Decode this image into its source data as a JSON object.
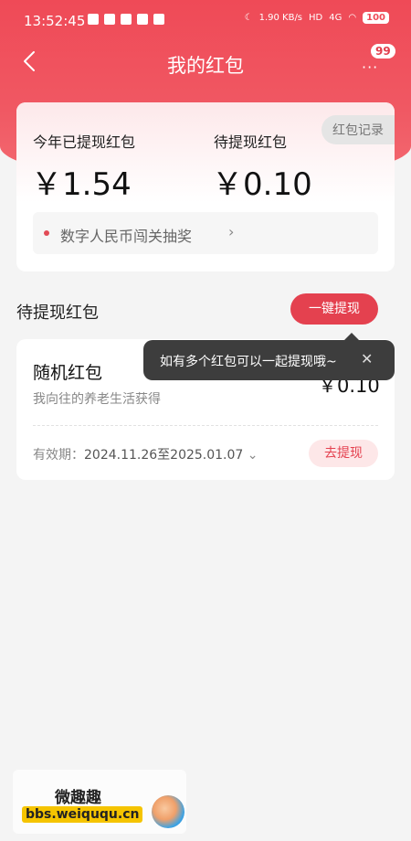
{
  "status_bar": {
    "time": "13:52:45",
    "network_speed": "1.90 KB/s",
    "hd_label": "HD",
    "signal_label": "4G",
    "battery": "100"
  },
  "nav": {
    "title": "我的红包",
    "more_glyph": "···",
    "badge_count": "99"
  },
  "summary": {
    "withdrawn_label": "今年已提现红包",
    "withdrawn_amount": "￥1.54",
    "pending_label": "待提现红包",
    "pending_amount": "￥0.10",
    "record_button": "红包记录",
    "lottery_text": "数字人民币闯关抽奖",
    "lottery_chevron": "›"
  },
  "section": {
    "title": "待提现红包",
    "withdraw_all_button": "一键提现"
  },
  "packet": {
    "name": "随机红包",
    "source": "我向往的养老生活获得",
    "amount": "￥0.10",
    "validity_label": "有效期：",
    "validity_dates": "2024.11.26至2025.01.07",
    "expand_glyph": "⌄",
    "withdraw_button": "去提现"
  },
  "tooltip": {
    "text": "如有多个红包可以一起提现哦~",
    "close_glyph": "✕"
  },
  "watermark": {
    "title": "微趣趣",
    "url": "bbs.weiququ.cn"
  },
  "colors": {
    "accent": "#e4414f",
    "hero_top": "#ef4a57",
    "tooltip_bg": "#3d3d3d"
  }
}
